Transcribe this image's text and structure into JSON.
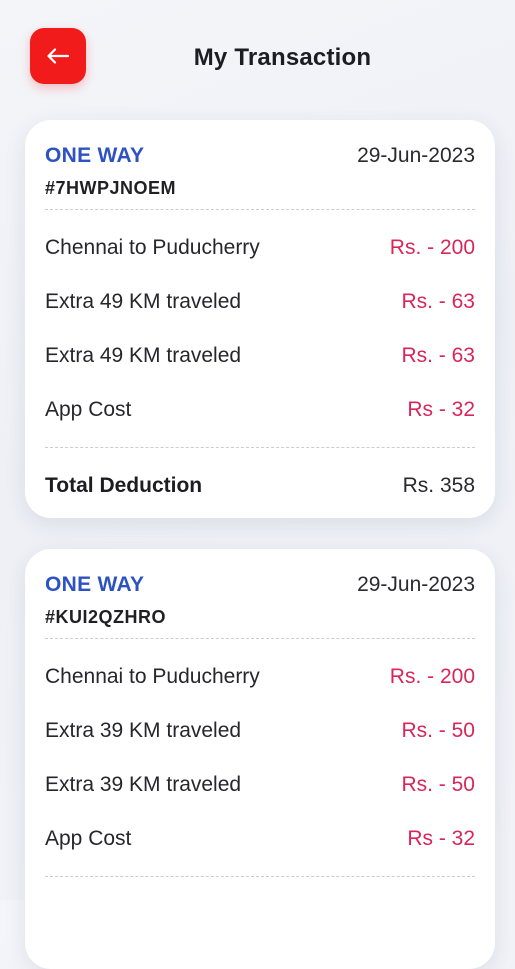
{
  "header": {
    "title": "My Transaction",
    "back_icon": "arrow-left-icon"
  },
  "colors": {
    "accent": "#f21b1b",
    "trip_type": "#2d52c2",
    "amount": "#d8265a"
  },
  "transactions": [
    {
      "trip_type": "ONE WAY",
      "date": "29-Jun-2023",
      "booking_id": "#7HWPJNOEM",
      "items": [
        {
          "label": "Chennai to Puducherry",
          "amount": "Rs. - 200"
        },
        {
          "label": "Extra 49 KM traveled",
          "amount": "Rs. - 63"
        },
        {
          "label": "Extra 49 KM traveled",
          "amount": "Rs. - 63"
        },
        {
          "label": "App Cost",
          "amount": "Rs - 32"
        }
      ],
      "total_label": "Total Deduction",
      "total_amount": "Rs. 358"
    },
    {
      "trip_type": "ONE WAY",
      "date": "29-Jun-2023",
      "booking_id": "#KUI2QZHRO",
      "items": [
        {
          "label": "Chennai to Puducherry",
          "amount": "Rs. - 200"
        },
        {
          "label": "Extra 39 KM traveled",
          "amount": "Rs. - 50"
        },
        {
          "label": "Extra 39 KM traveled",
          "amount": "Rs. - 50"
        },
        {
          "label": "App Cost",
          "amount": "Rs - 32"
        }
      ]
    }
  ]
}
